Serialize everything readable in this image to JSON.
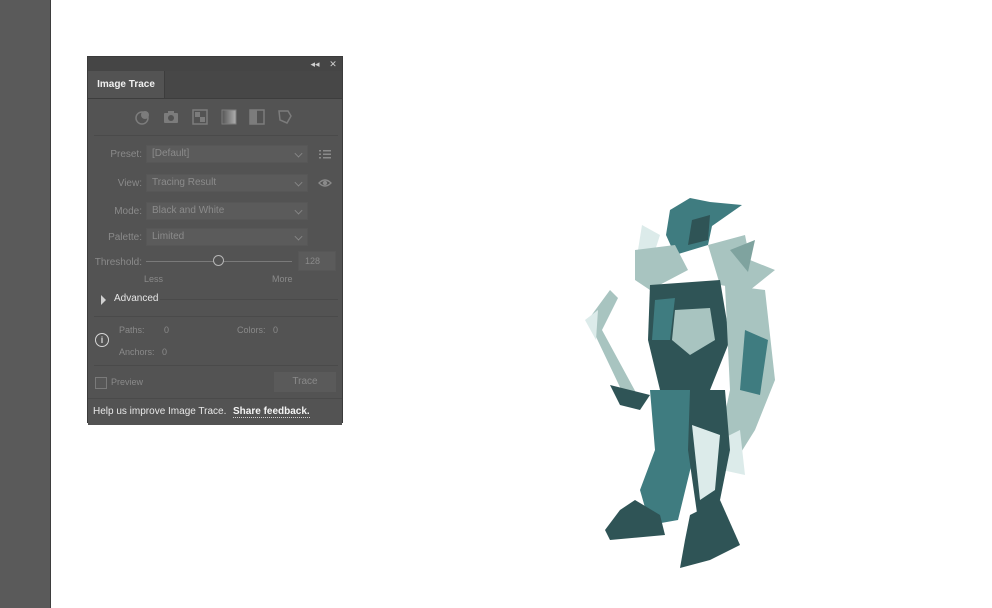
{
  "panel": {
    "collapse_icon": "◂◂",
    "close_icon": "✕",
    "tab_title": "Image Trace",
    "presets_icons": [
      "auto-color-icon",
      "high-color-icon",
      "low-color-icon",
      "grayscale-icon",
      "black-white-icon",
      "outline-icon"
    ],
    "preset": {
      "label": "Preset:",
      "value": "[Default]"
    },
    "view": {
      "label": "View:",
      "value": "Tracing Result"
    },
    "mode": {
      "label": "Mode:",
      "value": "Black and White"
    },
    "palette": {
      "label": "Palette:",
      "value": "Limited"
    },
    "threshold": {
      "label": "Threshold:",
      "value": "128",
      "less": "Less",
      "more": "More",
      "level": 128
    },
    "advanced_label": "Advanced",
    "stats": {
      "paths_label": "Paths:",
      "paths_value": "0",
      "colors_label": "Colors:",
      "colors_value": "0",
      "anchors_label": "Anchors:",
      "anchors_value": "0"
    },
    "preview_label": "Preview",
    "trace_button": "Trace",
    "footer_text": "Help us improve Image Trace.",
    "footer_link": "Share feedback."
  },
  "colors": {
    "panel_bg": "#535353",
    "figure_dark": "#2f5456",
    "figure_mid": "#3f7c80",
    "figure_light": "#a8c4c0",
    "figure_pale": "#dcebea"
  }
}
